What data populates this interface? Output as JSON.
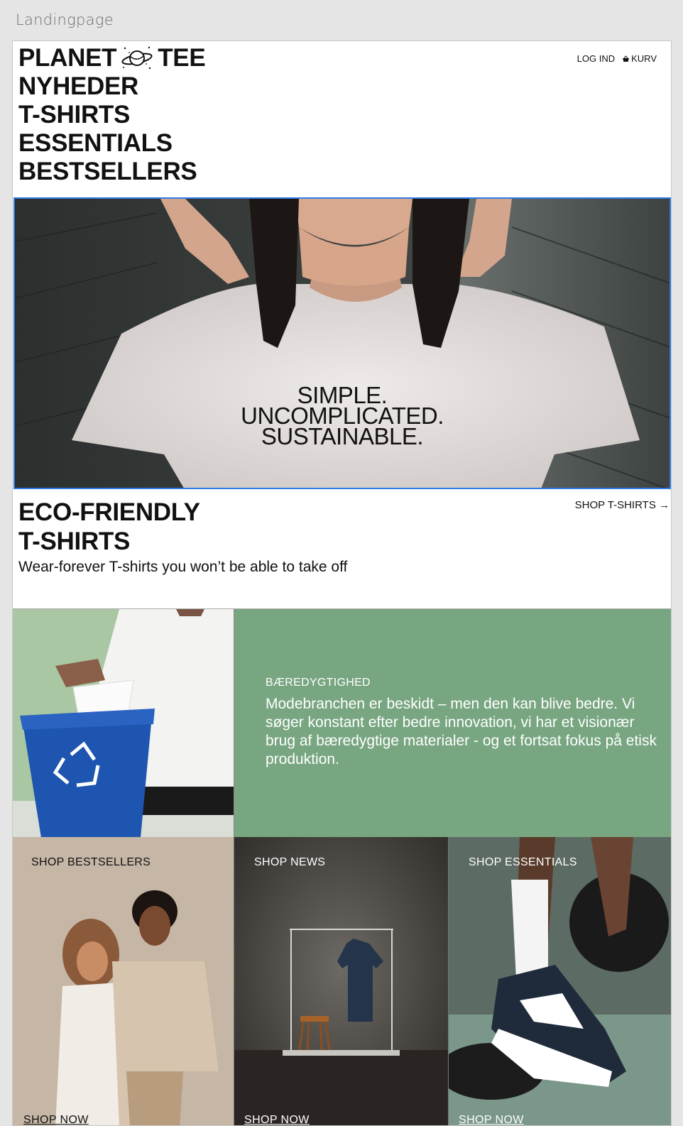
{
  "frame": {
    "title": "Landingpage"
  },
  "header": {
    "brand_left": "PLANET",
    "brand_right": "TEE",
    "nav": [
      "NYHEDER",
      "T-SHIRTS",
      "ESSENTIALS",
      "BESTSELLERS"
    ],
    "login": "LOG IND",
    "cart": "KURV"
  },
  "hero": {
    "line1": "SIMPLE.",
    "line2": "UNCOMPLICATED.",
    "line3": "SUSTAINABLE."
  },
  "eco": {
    "title_line1": "ECO-FRIENDLY",
    "title_line2": "T-SHIRTS",
    "subtitle": "Wear-forever T-shirts you won’t be able to take off",
    "shop_link": "SHOP T-SHIRTS →"
  },
  "sustainability": {
    "kicker": "BÆREDYGTIGHED",
    "text": "Modebranchen er beskidt – men den kan blive bedre. Vi søger konstant efter bedre innovation, vi har et visionær brug af bæredygtige materialer - og et fortsat fokus på etisk produktion."
  },
  "tiles": [
    {
      "title": "SHOP BESTSELLERS",
      "cta": "SHOP NOW"
    },
    {
      "title": "SHOP NEWS",
      "cta": "SHOP NOW"
    },
    {
      "title": "SHOP ESSENTIALS",
      "cta": "SHOP NOW"
    }
  ],
  "colors": {
    "accent_green": "#78a681",
    "selection_blue": "#2f7ae5"
  }
}
